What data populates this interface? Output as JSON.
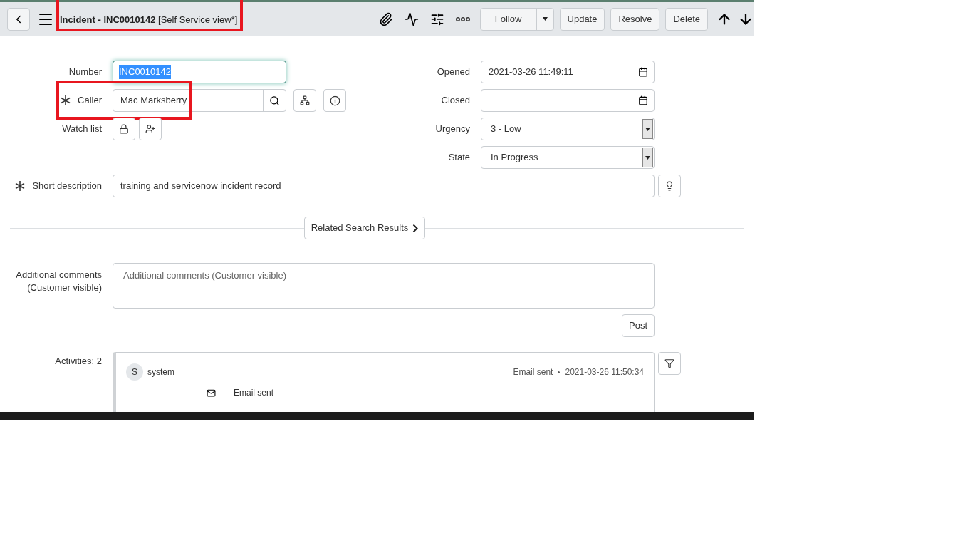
{
  "header": {
    "title": {
      "record": "Incident - INC0010142",
      "view": "[Self Service view*]",
      "highlighted": true
    },
    "follow": {
      "label": "Follow"
    },
    "buttons": [
      "Update",
      "Resolve",
      "Delete"
    ]
  },
  "form": {
    "left": [
      {
        "kind": "text",
        "label": "Number",
        "value": "INC0010142",
        "focused": true
      },
      {
        "kind": "reference",
        "label": "Caller",
        "value": "Mac Marksberry",
        "required": true,
        "highlighted": true
      },
      {
        "kind": "watchlist",
        "label": "Watch list"
      }
    ],
    "right": [
      {
        "kind": "date",
        "label": "Opened",
        "value": "2021-03-26 11:49:11"
      },
      {
        "kind": "date",
        "label": "Closed"
      },
      {
        "kind": "select",
        "label": "Urgency",
        "value": "3 - Low"
      },
      {
        "kind": "select",
        "label": "State",
        "value": "In Progress"
      }
    ],
    "short_description": {
      "label": "Short description",
      "value": "training and servicenow incident record",
      "required": true
    },
    "related_search": {
      "label": "Related Search Results"
    },
    "comments": {
      "label": "Additional comments (Customer visible)",
      "placeholder": "Additional comments (Customer visible)",
      "post": "Post"
    },
    "activities": {
      "label": "Activities: 2",
      "entries": [
        {
          "avatar": "S",
          "author": "system",
          "type": "Email sent",
          "time": "2021-03-26 11:50:34",
          "detail": "Email sent"
        }
      ]
    }
  }
}
